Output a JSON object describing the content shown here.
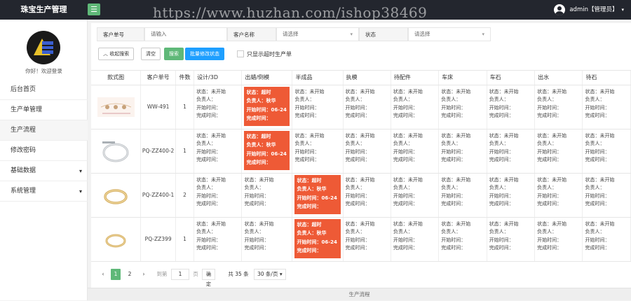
{
  "app": {
    "title": "珠宝生产管理",
    "menu_icon": "☰",
    "watermark": "https://www.huzhan.com/ishop38469"
  },
  "user": {
    "name": "admin【管理员】",
    "caret": "▾"
  },
  "sidebar": {
    "welcome": "你好！欢迎登录",
    "items": [
      {
        "label": "后台首页",
        "arrow": ""
      },
      {
        "label": "生产单管理",
        "arrow": ""
      },
      {
        "label": "生产流程",
        "arrow": ""
      },
      {
        "label": "修改密码",
        "arrow": ""
      },
      {
        "label": "基础数据",
        "arrow": "▾"
      },
      {
        "label": "系统管理",
        "arrow": "▾"
      }
    ],
    "active_index": 2
  },
  "filters": {
    "customer_no": {
      "label": "客户单号",
      "placeholder": "请输入"
    },
    "customer_name": {
      "label": "客户名称",
      "placeholder": "请选择",
      "dd": "▾"
    },
    "status": {
      "label": "状态",
      "placeholder": "请选择",
      "dd": "▾"
    },
    "collapse_label": "收起搜索",
    "clear_label": "清空",
    "search_label": "搜索",
    "batch_label": "批量修改状态",
    "overdue_label": "只显示超时生产单"
  },
  "table": {
    "headers": [
      "款式图",
      "客户单号",
      "件数",
      "设计/3D",
      "出蜡/倒模",
      "半成品",
      "执模",
      "待配件",
      "车床",
      "车石",
      "出水",
      "待石"
    ],
    "rows": [
      {
        "order_no": "WW-491",
        "qty": "1",
        "stages": [
          {
            "late": false,
            "l1": "状态：未开始",
            "l2": "负责人：",
            "l3": "开始时间：",
            "l4": "完成时间："
          },
          {
            "late": true,
            "l1": "状态：超时",
            "l2": "负责人：秋华",
            "l3": "开始时间：06-24",
            "l4": "完成时间："
          },
          {
            "late": false,
            "l1": "状态：未开始",
            "l2": "负责人：",
            "l3": "开始时间：",
            "l4": "完成时间："
          },
          {
            "late": false,
            "l1": "状态：未开始",
            "l2": "负责人：",
            "l3": "开始时间：",
            "l4": "完成时间："
          },
          {
            "late": false,
            "l1": "状态：未开始",
            "l2": "负责人：",
            "l3": "开始时间：",
            "l4": "完成时间："
          },
          {
            "late": false,
            "l1": "状态：未开始",
            "l2": "负责人：",
            "l3": "开始时间：",
            "l4": "完成时间："
          },
          {
            "late": false,
            "l1": "状态：未开始",
            "l2": "负责人：",
            "l3": "开始时间：",
            "l4": "完成时间："
          },
          {
            "late": false,
            "l1": "状态：未开始",
            "l2": "负责人：",
            "l3": "开始时间：",
            "l4": "完成时间："
          },
          {
            "late": false,
            "l1": "状态：未开始",
            "l2": "负责人：",
            "l3": "开始时间：",
            "l4": "完成时间："
          }
        ]
      },
      {
        "order_no": "PQ-ZZ400-2",
        "qty": "1",
        "stages": [
          {
            "late": false,
            "l1": "状态：未开始",
            "l2": "负责人：",
            "l3": "开始时间：",
            "l4": "完成时间："
          },
          {
            "late": true,
            "l1": "状态：超时",
            "l2": "负责人：秋华",
            "l3": "开始时间：06-24",
            "l4": "完成时间："
          },
          {
            "late": false,
            "l1": "状态：未开始",
            "l2": "负责人：",
            "l3": "开始时间：",
            "l4": "完成时间："
          },
          {
            "late": false,
            "l1": "状态：未开始",
            "l2": "负责人：",
            "l3": "开始时间：",
            "l4": "完成时间："
          },
          {
            "late": false,
            "l1": "状态：未开始",
            "l2": "负责人：",
            "l3": "开始时间：",
            "l4": "完成时间："
          },
          {
            "late": false,
            "l1": "状态：未开始",
            "l2": "负责人：",
            "l3": "开始时间：",
            "l4": "完成时间："
          },
          {
            "late": false,
            "l1": "状态：未开始",
            "l2": "负责人：",
            "l3": "开始时间：",
            "l4": "完成时间："
          },
          {
            "late": false,
            "l1": "状态：未开始",
            "l2": "负责人：",
            "l3": "开始时间：",
            "l4": "完成时间："
          },
          {
            "late": false,
            "l1": "状态：未开始",
            "l2": "负责人：",
            "l3": "开始时间：",
            "l4": "完成时间："
          }
        ]
      },
      {
        "order_no": "PQ-ZZ400-1",
        "qty": "2",
        "stages": [
          {
            "late": false,
            "l1": "状态：未开始",
            "l2": "负责人：",
            "l3": "开始时间：",
            "l4": "完成时间："
          },
          {
            "late": false,
            "l1": "状态：未开始",
            "l2": "负责人：",
            "l3": "开始时间：",
            "l4": "完成时间："
          },
          {
            "late": true,
            "l1": "状态：超时",
            "l2": "负责人：秋华",
            "l3": "开始时间：06-24",
            "l4": "完成时间："
          },
          {
            "late": false,
            "l1": "状态：未开始",
            "l2": "负责人：",
            "l3": "开始时间：",
            "l4": "完成时间："
          },
          {
            "late": false,
            "l1": "状态：未开始",
            "l2": "负责人：",
            "l3": "开始时间：",
            "l4": "完成时间："
          },
          {
            "late": false,
            "l1": "状态：未开始",
            "l2": "负责人：",
            "l3": "开始时间：",
            "l4": "完成时间："
          },
          {
            "late": false,
            "l1": "状态：未开始",
            "l2": "负责人：",
            "l3": "开始时间：",
            "l4": "完成时间："
          },
          {
            "late": false,
            "l1": "状态：未开始",
            "l2": "负责人：",
            "l3": "开始时间：",
            "l4": "完成时间："
          },
          {
            "late": false,
            "l1": "状态：未开始",
            "l2": "负责人：",
            "l3": "开始时间：",
            "l4": "完成时间："
          }
        ]
      },
      {
        "order_no": "PQ-ZZ399",
        "qty": "1",
        "stages": [
          {
            "late": false,
            "l1": "状态：未开始",
            "l2": "负责人：",
            "l3": "开始时间：",
            "l4": "完成时间："
          },
          {
            "late": false,
            "l1": "状态：未开始",
            "l2": "负责人：",
            "l3": "开始时间：",
            "l4": "完成时间："
          },
          {
            "late": true,
            "l1": "状态：超时",
            "l2": "负责人：秋华",
            "l3": "开始时间：06-24",
            "l4": "完成时间："
          },
          {
            "late": false,
            "l1": "状态：未开始",
            "l2": "负责人：",
            "l3": "开始时间：",
            "l4": "完成时间："
          },
          {
            "late": false,
            "l1": "状态：未开始",
            "l2": "负责人：",
            "l3": "开始时间：",
            "l4": "完成时间："
          },
          {
            "late": false,
            "l1": "状态：未开始",
            "l2": "负责人：",
            "l3": "开始时间：",
            "l4": "完成时间："
          },
          {
            "late": false,
            "l1": "状态：未开始",
            "l2": "负责人：",
            "l3": "开始时间：",
            "l4": "完成时间："
          },
          {
            "late": false,
            "l1": "状态：未开始",
            "l2": "负责人：",
            "l3": "开始时间：",
            "l4": "完成时间："
          },
          {
            "late": false,
            "l1": "状态：未开始",
            "l2": "负责人：",
            "l3": "开始时间：",
            "l4": "完成时间："
          }
        ]
      }
    ]
  },
  "pager": {
    "prev": "‹",
    "page1": "1",
    "page2": "2",
    "next": "›",
    "goto_label": "到第",
    "goto_value": "1",
    "page_unit": "页",
    "confirm": "确定",
    "total": "共 35 条",
    "per_page": "30 条/页 ▾"
  },
  "footer": {
    "text": "生产流程"
  },
  "colors": {
    "accent": "#5fb878",
    "overdue": "#ee5a36",
    "primary": "#1e9fff",
    "topbar": "#23262e"
  }
}
